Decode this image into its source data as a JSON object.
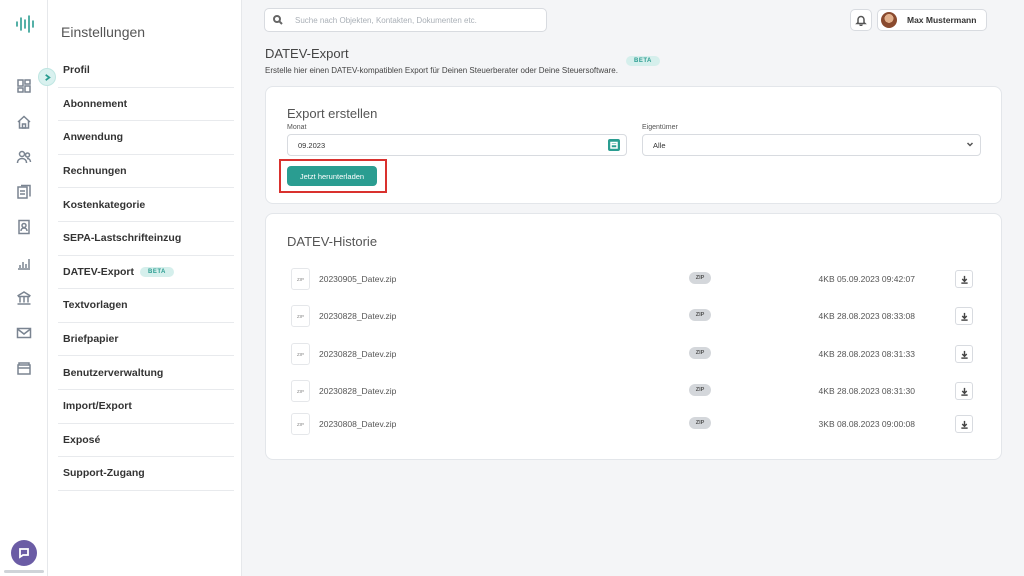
{
  "app": {
    "logo_icon": "waveform-logo-icon",
    "accent_color": "#2a9d91"
  },
  "rail": {
    "icons": [
      "dashboard-icon",
      "home-icon",
      "contacts-icon",
      "documents-icon",
      "contract-icon",
      "chart-icon",
      "bank-icon",
      "mail-icon",
      "archive-icon"
    ],
    "chat_icon": "chat-icon"
  },
  "settings": {
    "title": "Einstellungen",
    "items": [
      {
        "label": "Profil"
      },
      {
        "label": "Abonnement"
      },
      {
        "label": "Anwendung"
      },
      {
        "label": "Rechnungen"
      },
      {
        "label": "Kostenkategorie"
      },
      {
        "label": "SEPA-Lastschrifteinzug"
      },
      {
        "label": "DATEV-Export",
        "badge": "BETA"
      },
      {
        "label": "Textvorlagen"
      },
      {
        "label": "Briefpapier"
      },
      {
        "label": "Benutzerverwaltung"
      },
      {
        "label": "Import/Export"
      },
      {
        "label": "Exposé"
      },
      {
        "label": "Support-Zugang"
      }
    ]
  },
  "topbar": {
    "search_placeholder": "Suche nach Objekten, Kontakten, Dokumenten etc.",
    "user_name": "Max Mustermann"
  },
  "page": {
    "title": "DATEV-Export",
    "badge": "BETA",
    "description": "Erstelle hier einen DATEV-kompatiblen Export für Deinen Steuerberater oder Deine Steuersoftware."
  },
  "export": {
    "title": "Export erstellen",
    "month_label": "Monat",
    "month_value": "09.2023",
    "owner_label": "Eigentümer",
    "owner_value": "Alle",
    "download_label": "Jetzt herunterladen"
  },
  "history": {
    "title": "DATEV-Historie",
    "file_icon_label": "ZIP",
    "rows": [
      {
        "name": "20230905_Datev.zip",
        "type": "ZIP",
        "size": "4KB",
        "date": "05.09.2023 09:42:07"
      },
      {
        "name": "20230828_Datev.zip",
        "type": "ZIP",
        "size": "4KB",
        "date": "28.08.2023 08:33:08"
      },
      {
        "name": "20230828_Datev.zip",
        "type": "ZIP",
        "size": "4KB",
        "date": "28.08.2023 08:31:33"
      },
      {
        "name": "20230828_Datev.zip",
        "type": "ZIP",
        "size": "4KB",
        "date": "28.08.2023 08:31:30"
      },
      {
        "name": "20230808_Datev.zip",
        "type": "ZIP",
        "size": "3KB",
        "date": "08.08.2023 09:00:08"
      }
    ]
  }
}
